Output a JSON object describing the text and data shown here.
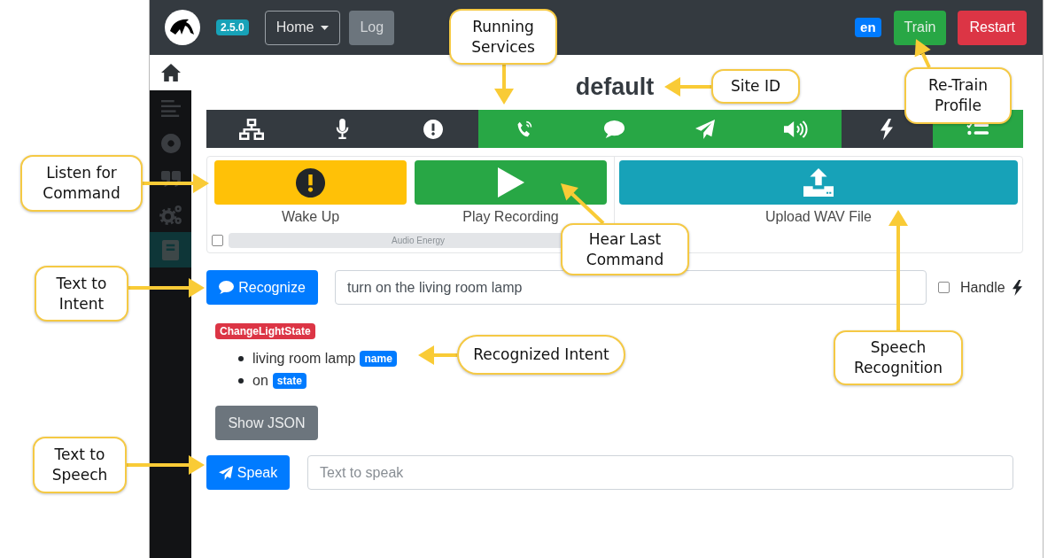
{
  "header": {
    "version": "2.5.0",
    "menu": "Home",
    "log_button": "Log",
    "language": "en",
    "train_button": "Train",
    "restart_button": "Restart"
  },
  "sidebar": {
    "items": [
      {
        "selected": true,
        "highlighted": false
      },
      {
        "selected": false,
        "highlighted": false
      },
      {
        "selected": false,
        "highlighted": false
      },
      {
        "selected": false,
        "highlighted": false
      },
      {
        "selected": false,
        "highlighted": false
      },
      {
        "selected": false,
        "highlighted": true
      }
    ]
  },
  "site_id": "default",
  "services": [
    {
      "running": false
    },
    {
      "running": false
    },
    {
      "running": false
    },
    {
      "running": true
    },
    {
      "running": true
    },
    {
      "running": true
    },
    {
      "running": true
    },
    {
      "running": false
    },
    {
      "running": true
    }
  ],
  "actions": [
    {
      "kind": "wake",
      "label": "Wake Up"
    },
    {
      "kind": "play",
      "label": "Play Recording"
    },
    {
      "kind": "upload",
      "label": "Upload WAV File"
    }
  ],
  "audio_energy": {
    "checked": false,
    "label": "Audio Energy"
  },
  "recognize": {
    "button": "Recognize",
    "value": "turn on the living room lamp",
    "handle": {
      "label": "Handle",
      "checked": false
    }
  },
  "intent": {
    "name": "ChangeLightState",
    "slots": [
      {
        "value": "living room lamp",
        "entity": "name"
      },
      {
        "value": "on",
        "entity": "state"
      }
    ]
  },
  "show_json_button": "Show JSON",
  "speak": {
    "button": "Speak",
    "placeholder": "Text to speak"
  },
  "callouts": [
    "Running Services",
    "Site ID",
    "Re-Train Profile",
    "Listen for Command",
    "Hear Last Command",
    "Text to Intent",
    "Recognized Intent",
    "Speech Recognition",
    "Text to Speech"
  ]
}
